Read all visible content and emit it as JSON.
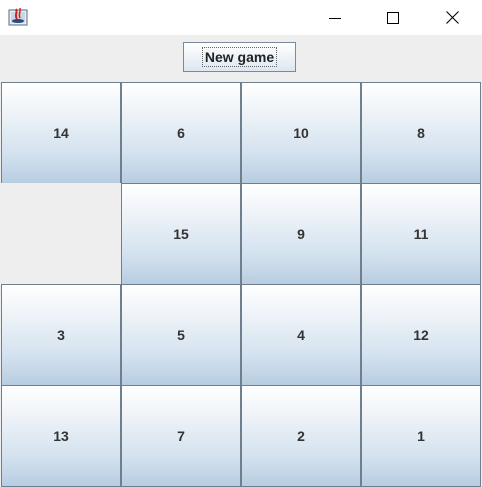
{
  "toolbar": {
    "new_game_label": "New game"
  },
  "board": {
    "rows": [
      [
        "14",
        "6",
        "10",
        "8"
      ],
      [
        "",
        "15",
        "9",
        "11"
      ],
      [
        "3",
        "5",
        "4",
        "12"
      ],
      [
        "13",
        "7",
        "2",
        "1"
      ]
    ]
  },
  "icons": {
    "app": "java-app-icon",
    "minimize": "minimize-icon",
    "maximize": "maximize-icon",
    "close": "close-icon"
  }
}
